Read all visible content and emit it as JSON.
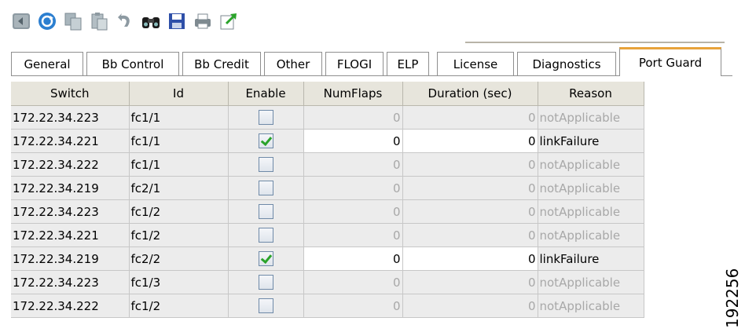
{
  "toolbar": {
    "icons": [
      "back-icon",
      "refresh-icon",
      "copy-icon",
      "paste-icon",
      "undo-icon",
      "find-icon",
      "save-icon",
      "print-icon",
      "export-icon"
    ]
  },
  "tabs": [
    {
      "label": "General"
    },
    {
      "label": "Bb Control"
    },
    {
      "label": "Bb Credit"
    },
    {
      "label": "Other"
    },
    {
      "label": "FLOGI"
    },
    {
      "label": "ELP"
    },
    {
      "label": "License"
    },
    {
      "label": "Diagnostics"
    },
    {
      "label": "Port Guard",
      "active": true
    }
  ],
  "table": {
    "columns": [
      "Switch",
      "Id",
      "Enable",
      "NumFlaps",
      "Duration (sec)",
      "Reason"
    ],
    "rows": [
      {
        "switch": "172.22.34.223",
        "id": "fc1/1",
        "enabled": false,
        "numflaps": "0",
        "duration": "0",
        "reason": "notApplicable"
      },
      {
        "switch": "172.22.34.221",
        "id": "fc1/1",
        "enabled": true,
        "numflaps": "0",
        "duration": "0",
        "reason": "linkFailure"
      },
      {
        "switch": "172.22.34.222",
        "id": "fc1/1",
        "enabled": false,
        "numflaps": "0",
        "duration": "0",
        "reason": "notApplicable"
      },
      {
        "switch": "172.22.34.219",
        "id": "fc2/1",
        "enabled": false,
        "numflaps": "0",
        "duration": "0",
        "reason": "notApplicable"
      },
      {
        "switch": "172.22.34.223",
        "id": "fc1/2",
        "enabled": false,
        "numflaps": "0",
        "duration": "0",
        "reason": "notApplicable"
      },
      {
        "switch": "172.22.34.221",
        "id": "fc1/2",
        "enabled": false,
        "numflaps": "0",
        "duration": "0",
        "reason": "notApplicable"
      },
      {
        "switch": "172.22.34.219",
        "id": "fc2/2",
        "enabled": true,
        "numflaps": "0",
        "duration": "0",
        "reason": "linkFailure"
      },
      {
        "switch": "172.22.34.223",
        "id": "fc1/3",
        "enabled": false,
        "numflaps": "0",
        "duration": "0",
        "reason": "notApplicable"
      },
      {
        "switch": "172.22.34.222",
        "id": "fc1/2",
        "enabled": false,
        "numflaps": "0",
        "duration": "0",
        "reason": "notApplicable"
      }
    ]
  },
  "figure_code": "192256",
  "colors": {
    "active_tab_accent": "#e8a33a",
    "check_green": "#2aa32a",
    "header_bg": "#e7e5dc"
  }
}
